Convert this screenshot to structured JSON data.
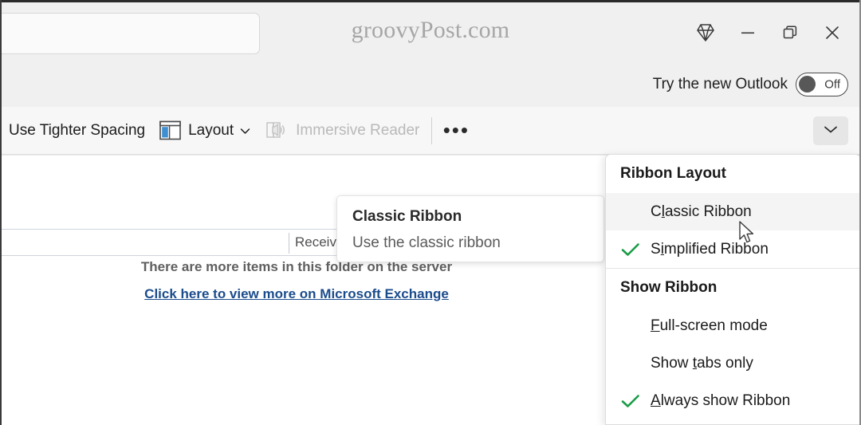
{
  "titlebar": {
    "brand": "groovyPost.com",
    "search_placeholder": "",
    "search_value": "",
    "buttons": [
      {
        "name": "diamond-icon",
        "label": ""
      },
      {
        "name": "minimize-icon",
        "label": ""
      },
      {
        "name": "restore-icon",
        "label": ""
      },
      {
        "name": "close-icon",
        "label": ""
      }
    ]
  },
  "try_new_outlook": {
    "label": "Try the new Outlook",
    "toggle_state": "Off"
  },
  "ribbon": {
    "tighter_spacing_label": "Use Tighter Spacing",
    "layout_label": "Layout",
    "layout_caret": "∨",
    "immersive_reader_label": "Immersive Reader",
    "overflow_label": "•••",
    "collapse_label": ""
  },
  "content": {
    "column_received": "Received",
    "more_items_text": "There are more items in this folder on the server",
    "more_items_link": "Click here to view more on Microsoft Exchange"
  },
  "tooltip": {
    "title": "Classic Ribbon",
    "description": "Use the classic ribbon"
  },
  "menu": {
    "sections": [
      {
        "title": "Ribbon Layout",
        "items": [
          {
            "label_pre": "C",
            "label_accel": "l",
            "label_post": "assic Ribbon",
            "checked": false,
            "hovered": true
          },
          {
            "label_pre": "S",
            "label_accel": "i",
            "label_post": "mplified Ribbon",
            "checked": true,
            "hovered": false
          }
        ]
      },
      {
        "title": "Show Ribbon",
        "items": [
          {
            "label_pre": "",
            "label_accel": "F",
            "label_post": "ull-screen mode",
            "checked": false,
            "hovered": false
          },
          {
            "label_pre": "Show ",
            "label_accel": "t",
            "label_post": "abs only",
            "checked": false,
            "hovered": false
          },
          {
            "label_pre": "",
            "label_accel": "A",
            "label_post": "lways show Ribbon",
            "checked": true,
            "hovered": false
          }
        ]
      }
    ]
  },
  "colors": {
    "accent_green": "#1a9c46",
    "link_blue": "#1b4c8c",
    "layout_icon_blue": "#3d8fd1",
    "titlebar_bg": "#f0f0f0",
    "ribbon_bg": "#f7f7f7",
    "menu_hover": "#f4f4f4"
  }
}
